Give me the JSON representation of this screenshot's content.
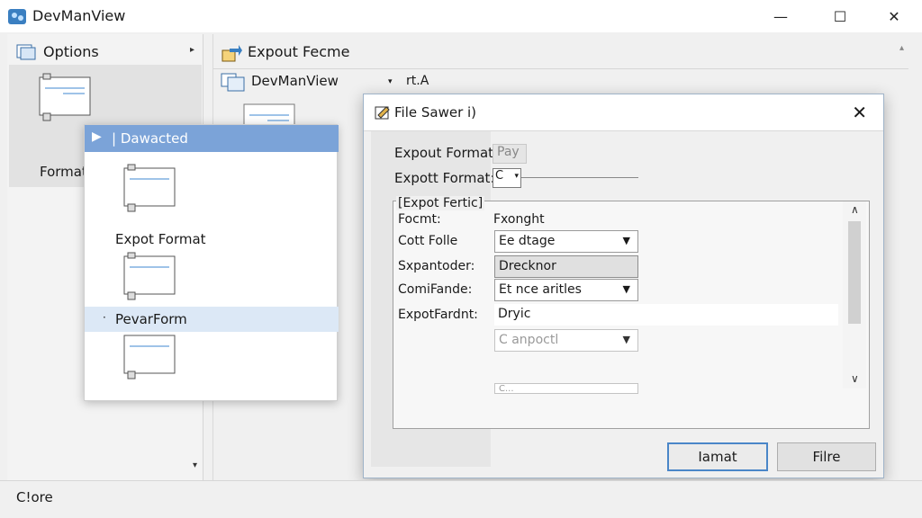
{
  "window": {
    "title": "DevManView",
    "minimize": "—",
    "maximize": "☐",
    "close": "✕"
  },
  "left_pane": {
    "options_label": "Options",
    "options_arrow": "▸",
    "tile_label": "Format",
    "scroll_down": "▾"
  },
  "center": {
    "header_label": "Expout Fecme",
    "up_arrow": "▴",
    "devman_label": "DevManView",
    "devman_arrow": "▾",
    "devman_extra": "rt.A"
  },
  "popup": {
    "header_glyph": "▶",
    "header_label": "| Dawacted",
    "item_label": "Expot Format",
    "selected_bullet": "·",
    "selected_label": "PevarForm"
  },
  "dialog": {
    "title": "File Sawer i)",
    "close": "✕",
    "row1_label": "Expout Format:",
    "row1_value": "Pay",
    "row2_label": "Expott Format:",
    "row2_value": "C",
    "row2_arrow": "▾",
    "group_title": "[Expot Fertic]",
    "rows": [
      {
        "label": "Focmt:",
        "value": "Fxonght"
      },
      {
        "label": "Cott Folle",
        "value": "Ee dtage",
        "arrow": "▼"
      },
      {
        "label": "Sxpantoder:",
        "value": "Drecknor"
      },
      {
        "label": "ComiFande:",
        "value": "Et nce aritles",
        "arrow": "▼"
      },
      {
        "label": "ExpotFardnt:",
        "value": "Dryic"
      },
      {
        "value": "C anpoctl",
        "arrow": "▼"
      },
      {
        "value": "C..."
      }
    ],
    "scroll_up": "∧",
    "scroll_down": "∨",
    "btn_primary": "Iamat",
    "btn_secondary": "Filre"
  },
  "status": {
    "text": "C!ore"
  },
  "colors": {
    "accent": "#4a86c8",
    "popup_header": "#7ba3d8",
    "selection": "#dce8f6"
  }
}
